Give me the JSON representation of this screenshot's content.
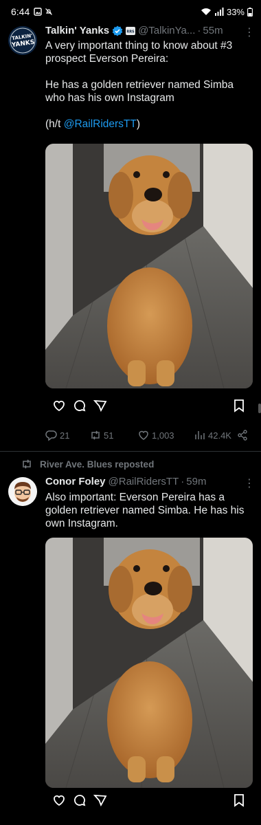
{
  "status": {
    "time": "6:44",
    "battery": "33%"
  },
  "tweet1": {
    "name": "Talkin' Yanks",
    "handle": "@TalkinYa...",
    "dot": "·",
    "time": "55m",
    "avatar_text": "TALKIN' YANKS",
    "text": "A very important thing to know about #3\nprospect Everson Pereira:\n\nHe has a golden retriever named Simba\nwho has his own Instagram\n\n(h/t ",
    "mention": "@RailRidersTT",
    "text_end": ")",
    "replies": "21",
    "reposts": "51",
    "likes": "1,003",
    "views": "42.4K"
  },
  "repost_banner": {
    "label": "River Ave. Blues reposted"
  },
  "tweet2": {
    "name": "Conor Foley",
    "handle": "@RailRidersTT",
    "dot": "·",
    "time": "59m",
    "text": "Also important: Everson Pereira has a\ngolden retriever named Simba. He has his\nown Instagram."
  },
  "icons": {
    "heart": "heart-icon",
    "comment": "comment-icon",
    "share": "share-icon",
    "bookmark": "bookmark-icon",
    "reply": "reply-icon",
    "repost": "repost-icon",
    "views": "views-icon",
    "more": "more-icon"
  },
  "colors": {
    "link": "#1d9bf0",
    "muted": "#71767b",
    "verified": "#1d9bf0"
  }
}
